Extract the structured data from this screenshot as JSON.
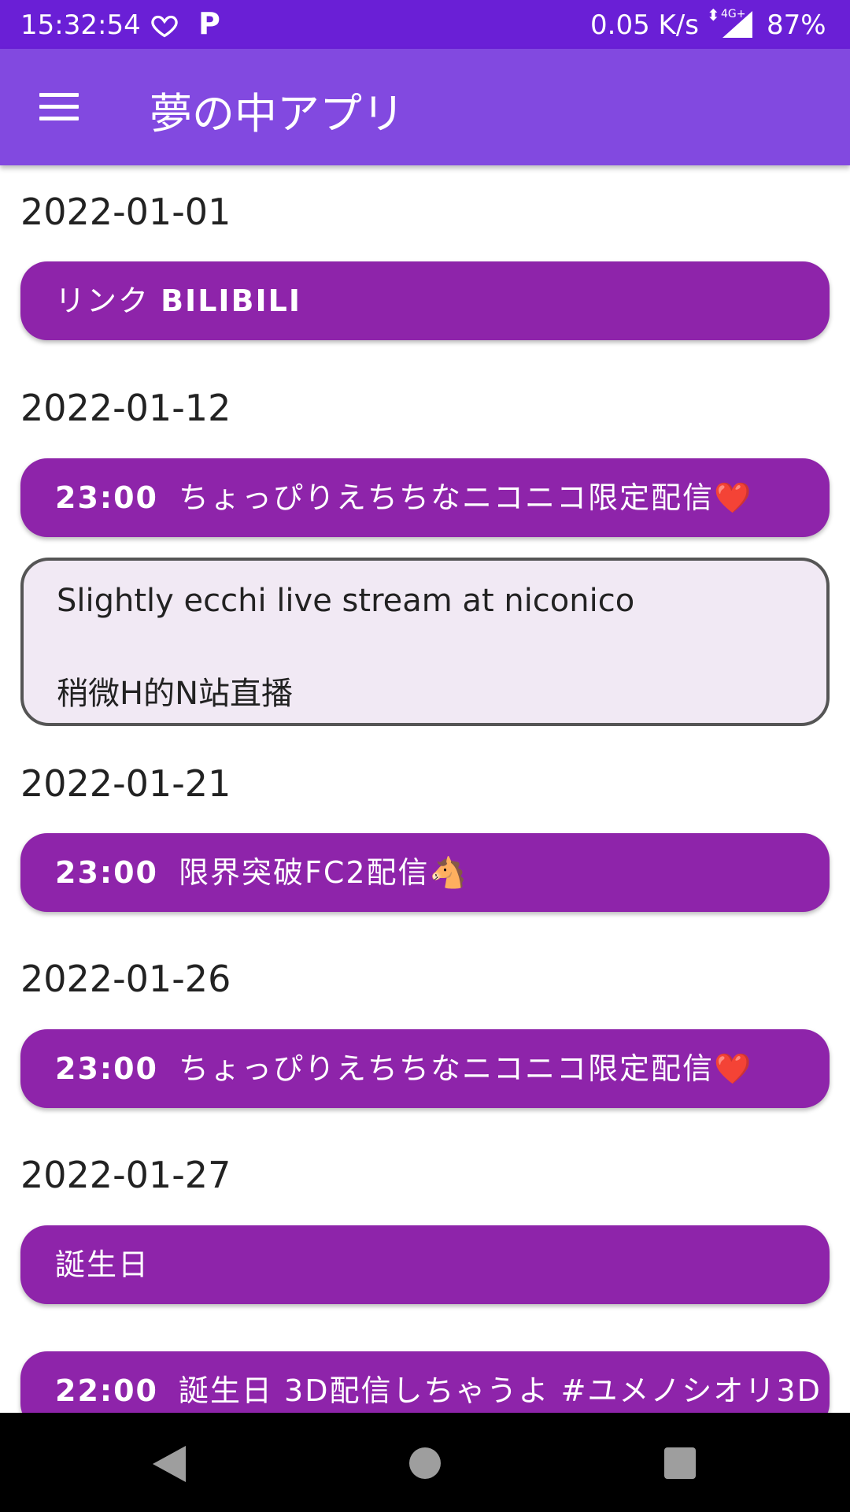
{
  "status_bar": {
    "time": "15:32:54",
    "p_label": "P",
    "net_speed": "0.05 K/s",
    "network_type": "4G+",
    "battery": "87%",
    "color": "#6a1fd6"
  },
  "app_bar": {
    "title": "夢の中アプリ",
    "color": "#8249e0"
  },
  "schedule": {
    "accent_color": "#8e24aa",
    "d1": {
      "date": "2022-01-01",
      "event_a": {
        "text_a": "リンク ",
        "text_b": "BILIBILI"
      }
    },
    "d2": {
      "date": "2022-01-12",
      "event": {
        "time": "23:00",
        "title": "ちょっぴりえちちなニコニコ限定配信❤️"
      },
      "detail": {
        "line1": "Slightly ecchi live stream at niconico",
        "line2": "稍微H的N站直播"
      }
    },
    "d3": {
      "date": "2022-01-21",
      "event": {
        "time": "23:00",
        "title": "限界突破FC2配信🐴"
      }
    },
    "d4": {
      "date": "2022-01-26",
      "event": {
        "time": "23:00",
        "title": "ちょっぴりえちちなニコニコ限定配信❤️"
      }
    },
    "d5": {
      "date": "2022-01-27",
      "event_a": {
        "title": "誕生日"
      },
      "event_b": {
        "time": "22:00",
        "title": "誕生日 3D配信しちゃうよ #ユメノシオリ3D"
      }
    }
  },
  "icons": {
    "menu": "hamburger-menu-icon",
    "heart": "heart-outline-icon",
    "signal": "signal-icon",
    "back": "back-triangle-icon",
    "home": "home-circle-icon",
    "recents": "recents-square-icon"
  }
}
